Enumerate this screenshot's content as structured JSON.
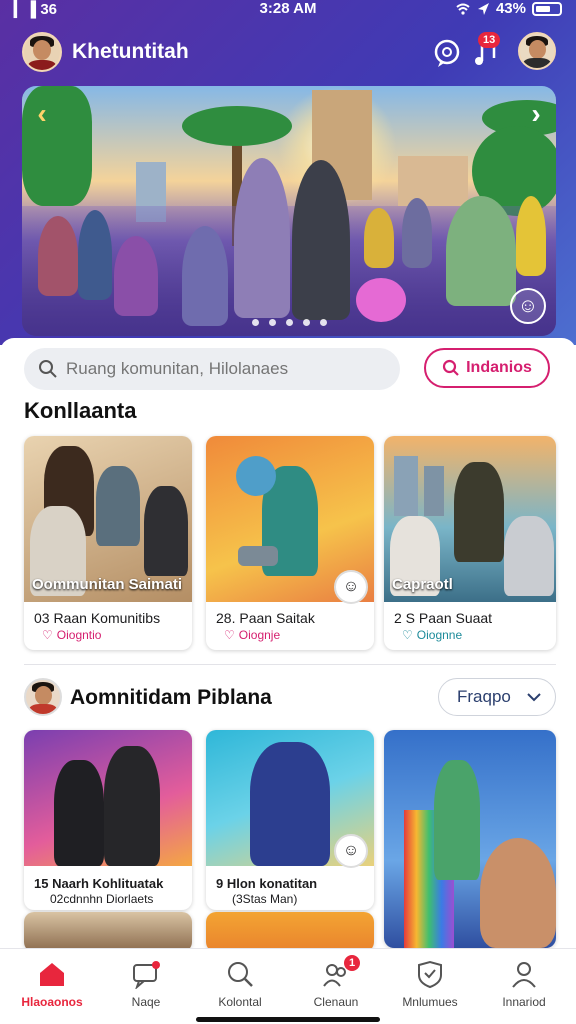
{
  "status_bar": {
    "signal": "▎▐ 36",
    "time": "3:28 AM",
    "battery": "43%"
  },
  "header": {
    "title": "Khetuntitah",
    "notification_badge": "13"
  },
  "banner": {
    "dots": 5,
    "active_dot": 0
  },
  "search": {
    "placeholder": "Ruang komunitan, Hilolanaes",
    "filter_label": "Indanios"
  },
  "section1": {
    "title": "Konllaanta",
    "cards": [
      {
        "caption": "Oommunitan Saimati",
        "line1": "03 Raan Komunitibs",
        "line2": "Oiogntio",
        "tone": "pink"
      },
      {
        "caption": "",
        "line1": "28. Paan Saitak",
        "line2": "Oiognje",
        "tone": "pink"
      },
      {
        "caption": "Capraotl",
        "line1": "2 S  Paan Suaat",
        "line2": "Oiognne",
        "tone": "teal"
      }
    ]
  },
  "section2": {
    "title": "Aomnitidam Piblana",
    "dropdown_label": "Fraqpo",
    "cards": [
      {
        "line1": "15 Naarh Kohlituatak",
        "line2": "02cdnnhn Diorlaets"
      },
      {
        "line1": "9 Hlon konatitan",
        "line2": "(3Stas Man)"
      },
      {
        "line1": "",
        "line2": ""
      }
    ]
  },
  "tabbar": {
    "items": [
      {
        "label": "Hlaoaonos",
        "icon": "home-icon",
        "active": true,
        "badge": ""
      },
      {
        "label": "Naqe",
        "icon": "chat-icon",
        "active": false,
        "badge": ""
      },
      {
        "label": "Kolontal",
        "icon": "search-icon",
        "active": false,
        "badge": ""
      },
      {
        "label": "Clenaun",
        "icon": "people-icon",
        "active": false,
        "badge": "1"
      },
      {
        "label": "Mnlumues",
        "icon": "shield-icon",
        "active": false,
        "badge": ""
      },
      {
        "label": "Innariod",
        "icon": "profile-icon",
        "active": false,
        "badge": ""
      }
    ]
  },
  "colors": {
    "accent": "#e8263d",
    "brand_purple": "#5a2fa3",
    "pink": "#d51f6f",
    "teal": "#1d8b9a"
  }
}
